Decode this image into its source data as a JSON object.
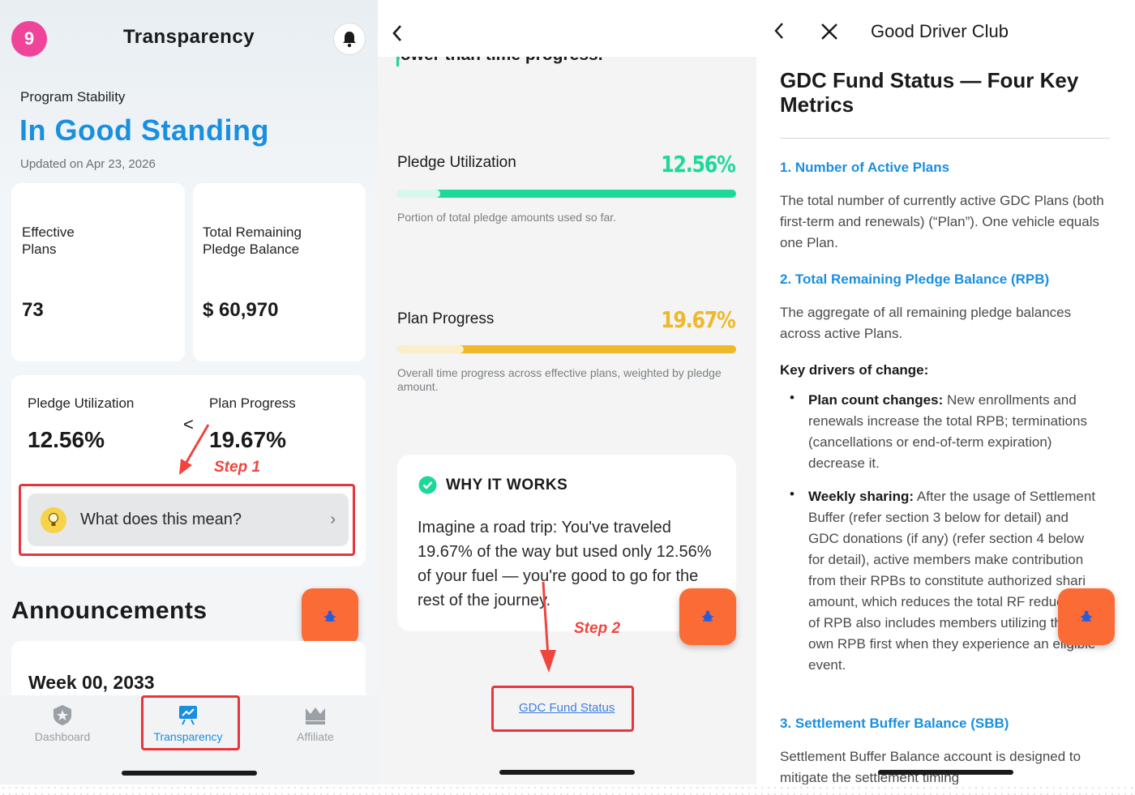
{
  "panel1": {
    "avatar_badge": "9",
    "title": "Transparency",
    "program_label": "Program Stability",
    "standing": "In Good Standing",
    "updated": "Updated on Apr 23, 2026",
    "cards": [
      {
        "label_line1": "Effective",
        "label_line2": "Plans",
        "value": "73"
      },
      {
        "label_line1": "Total Remaining",
        "label_line2": "Pledge Balance",
        "value": "$ 60,970"
      }
    ],
    "metrics": {
      "left_label": "Pledge Utilization",
      "left_value": "12.56%",
      "compare": "<",
      "right_label": "Plan Progress",
      "right_value": "19.67%"
    },
    "step_label": "Step 1",
    "what_button": "What does this mean?",
    "announcements": "Announcements",
    "week": "Week 00, 2033",
    "tabs": [
      "Dashboard",
      "Transparency",
      "Affiliate"
    ],
    "accent": "#1a8fe0"
  },
  "panel2": {
    "cut_text": "lower than time progress.",
    "utilization": {
      "title": "Pledge Utilization",
      "value": "12.56%",
      "percent": 12.56,
      "color": "#1ed89a",
      "desc": "Portion of total pledge amounts used so far."
    },
    "progress": {
      "title": "Plan Progress",
      "value": "19.67%",
      "percent": 19.67,
      "color": "#efb82b",
      "desc": "Overall time progress across effective plans, weighted by pledge amount."
    },
    "why_title": "WHY IT WORKS",
    "why_text": "Imagine a road trip: You've traveled 19.67% of the way but used only 12.56% of your fuel — you're good to go for the rest of the journey.",
    "step_label": "Step 2",
    "link": "GDC Fund Status"
  },
  "panel3": {
    "header": "Good Driver Club",
    "heading": "GDC Fund Status — Four Key Metrics",
    "sections": [
      {
        "title": "1. Number of Active Plans",
        "text": "The total number of currently active GDC Plans (both first-term and renewals) (“Plan”). One vehicle equals one Plan."
      },
      {
        "title": "2. Total Remaining Pledge Balance (RPB)",
        "text": "The aggregate of all remaining pledge balances across active Plans."
      }
    ],
    "drivers_title": "Key drivers of change:",
    "bullets": [
      {
        "lead": "Plan count changes:",
        "text": " New enrollments and renewals increase the total RPB; terminations (cancellations or end-of-term expiration) decrease it."
      },
      {
        "lead": "Weekly sharing:",
        "text": " After the usage of Settlement Buffer (refer section 3 below for detail) and GDC donations (if any) (refer section 4 below for detail), active members make contribution from their RPBs to constitute authorized shari amount, which reduces the total RF reduction of RPB also includes members utilizing their own RPB first when they experience an eligible event."
      }
    ],
    "section3_title": "3. Settlement Buffer Balance (SBB)",
    "section3_text": "Settlement Buffer Balance account is designed to mitigate the settlement timing"
  }
}
